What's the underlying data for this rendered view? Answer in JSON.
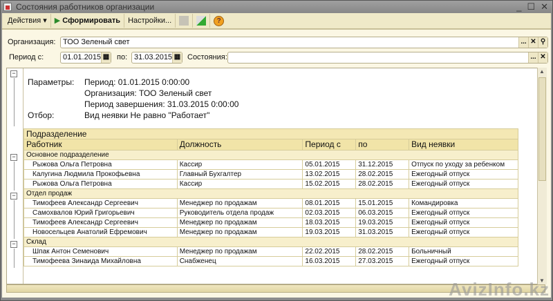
{
  "window": {
    "title": "Состояния работников организации"
  },
  "toolbar": {
    "actions": "Действия",
    "generate": "Сформировать",
    "settings": "Настройки...",
    "help": "?"
  },
  "filters": {
    "org_label": "Организация:",
    "org_value": "ТОО Зеленый свет",
    "period_from_label": "Период с:",
    "period_from": "01.01.2015",
    "period_to_label": "по:",
    "period_to": "31.03.2015",
    "states_label": "Состояния:",
    "states_value": "",
    "ellipsis": "...",
    "clear": "✕"
  },
  "report": {
    "params_label": "Параметры:",
    "param1": "Период: 01.01.2015 0:00:00",
    "param2": "Организация: ТОО Зеленый свет",
    "param3": "Период завершения: 31.03.2015 0:00:00",
    "filter_label": "Отбор:",
    "filter_value": "Вид неявки Не равно \"Работает\"",
    "columns": {
      "dept": "Подразделение",
      "employee": "Работник",
      "position": "Должность",
      "from": "Период с",
      "to": "по",
      "type": "Вид неявки"
    },
    "groups": [
      {
        "name": "Основное подразделение",
        "rows": [
          [
            "Рыжова Ольга Петровна",
            "Кассир",
            "05.01.2015",
            "31.12.2015",
            "Отпуск по уходу за ребенком"
          ],
          [
            "Калугина Людмила Прокофьевна",
            "Главный Бухгалтер",
            "13.02.2015",
            "28.02.2015",
            "Ежегодный отпуск"
          ],
          [
            "Рыжова Ольга Петровна",
            "Кассир",
            "15.02.2015",
            "28.02.2015",
            "Ежегодный отпуск"
          ]
        ]
      },
      {
        "name": "Отдел продаж",
        "rows": [
          [
            "Тимофеев Александр Сергеевич",
            "Менеджер по продажам",
            "08.01.2015",
            "15.01.2015",
            "Командировка"
          ],
          [
            "Самохвалов Юрий Григорьевич",
            "Руководитель отдела продаж",
            "02.03.2015",
            "06.03.2015",
            "Ежегодный отпуск"
          ],
          [
            "Тимофеев Александр Сергеевич",
            "Менеджер по продажам",
            "18.03.2015",
            "19.03.2015",
            "Ежегодный отпуск"
          ],
          [
            "Новосельцев Анатолий Ефремович",
            "Менеджер по продажам",
            "19.03.2015",
            "31.03.2015",
            "Ежегодный отпуск"
          ]
        ]
      },
      {
        "name": "Склад",
        "rows": [
          [
            "Шпак Антон Семенович",
            "Менеджер по продажам",
            "22.02.2015",
            "28.02.2015",
            "Больничный"
          ],
          [
            "Тимофеева Зинаида Михайловна",
            "Снабженец",
            "16.03.2015",
            "27.03.2015",
            "Ежегодный отпуск"
          ]
        ]
      }
    ]
  },
  "watermark": "AvizInfo.kz"
}
